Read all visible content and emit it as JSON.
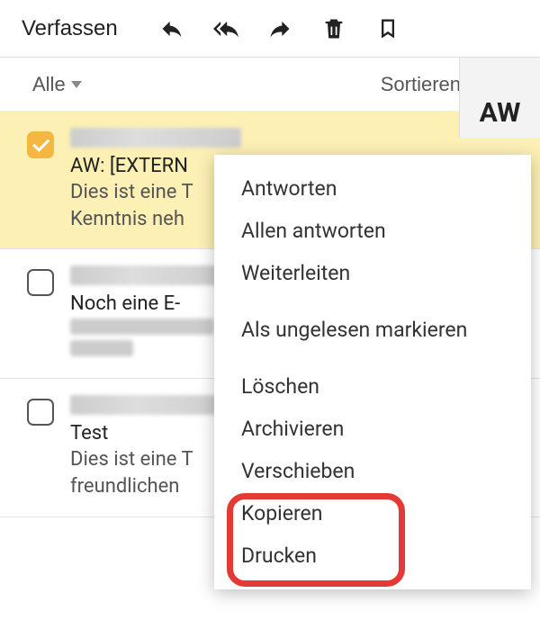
{
  "toolbar": {
    "compose_label": "Verfassen"
  },
  "filter": {
    "all_label": "Alle",
    "sort_label": "Sortieren"
  },
  "preview_header": "AW",
  "messages": [
    {
      "subject": "AW: [EXTERN",
      "preview": "Dies ist eine T\nKenntnis neh"
    },
    {
      "subject": "Noch eine E-",
      "preview": ""
    },
    {
      "subject": "Test",
      "preview": "Dies ist eine T\nfreundlichen"
    }
  ],
  "context_menu": {
    "reply": "Antworten",
    "reply_all": "Allen antworten",
    "forward": "Weiterleiten",
    "mark_unread": "Als ungelesen markieren",
    "delete": "Löschen",
    "archive": "Archivieren",
    "move": "Verschieben",
    "copy": "Kopieren",
    "print": "Drucken"
  }
}
